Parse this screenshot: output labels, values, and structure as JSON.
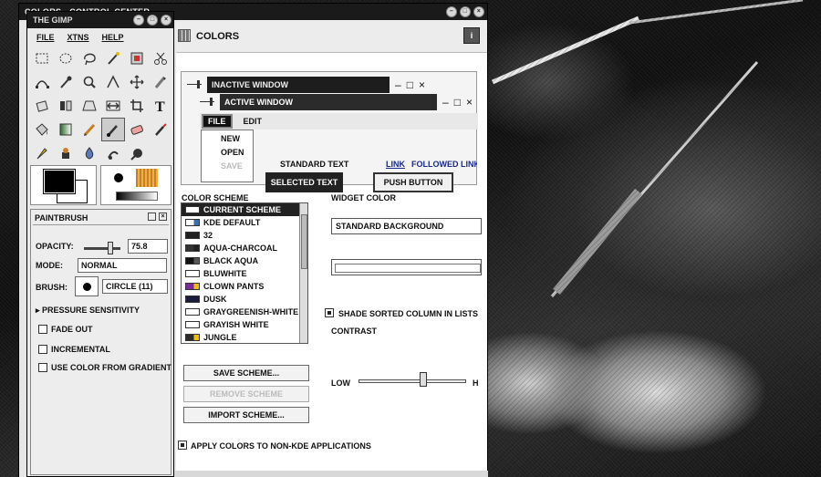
{
  "colors_window": {
    "title": "COLORS - CONTROL CENTER",
    "header_title": "COLORS",
    "info_label": "i"
  },
  "preview": {
    "inactive_title": "INACTIVE WINDOW",
    "active_title": "ACTIVE WINDOW",
    "menu_file": "FILE",
    "menu_edit": "EDIT",
    "dropdown": [
      "NEW",
      "OPEN",
      "SAVE"
    ],
    "standard_text": "STANDARD TEXT",
    "selected_text": "SELECTED TEXT",
    "link": "LINK",
    "followed_link": "FOLLOWED LINK",
    "push_button": "PUSH BUTTON"
  },
  "color_scheme": {
    "label": "COLOR SCHEME",
    "items": [
      {
        "name": "CURRENT SCHEME",
        "swatch": "#ffffff",
        "accent": "#ffffff",
        "selected": true
      },
      {
        "name": "KDE DEFAULT",
        "swatch": "#ffffff",
        "accent": "#3a6fb0"
      },
      {
        "name": "32",
        "swatch": "#222222",
        "accent": "#222222"
      },
      {
        "name": "AQUA-CHARCOAL",
        "swatch": "#333333",
        "accent": "#222222"
      },
      {
        "name": "BLACK AQUA",
        "swatch": "#111111",
        "accent": "#555555"
      },
      {
        "name": "BLUWHITE",
        "swatch": "#ffffff",
        "accent": "#ffffff"
      },
      {
        "name": "CLOWN PANTS",
        "swatch": "#7a2a9a",
        "accent": "#f0c000"
      },
      {
        "name": "DUSK",
        "swatch": "#1a1a3a",
        "accent": "#1a1a3a"
      },
      {
        "name": "GRAYGREENISH-WHITE",
        "swatch": "#ffffff",
        "accent": "#ffffff"
      },
      {
        "name": "GRAYISH WHITE",
        "swatch": "#ffffff",
        "accent": "#ffffff"
      },
      {
        "name": "JUNGLE",
        "swatch": "#2a2a2a",
        "accent": "#f0c000"
      },
      {
        "name": "...",
        "swatch": "#dddddd",
        "accent": "#dddddd"
      }
    ],
    "save_button": "SAVE SCHEME...",
    "remove_button": "REMOVE SCHEME",
    "import_button": "IMPORT SCHEME..."
  },
  "widget_color": {
    "label": "WIDGET COLOR",
    "selected_widget": "STANDARD BACKGROUND",
    "shade_sorted": "SHADE SORTED COLUMN IN LISTS",
    "contrast_label": "CONTRAST",
    "low_label": "LOW",
    "high_label": "H",
    "contrast_level": 0.6
  },
  "apply_nonkde": "APPLY COLORS TO NON-KDE APPLICATIONS",
  "gimp": {
    "title": "THE GIMP",
    "menu": [
      "FILE",
      "XTNS",
      "HELP"
    ],
    "tools": [
      "rect-select-icon",
      "ellipse-select-icon",
      "lasso-icon",
      "magic-wand-icon",
      "color-select-icon",
      "scissors-icon",
      "bezier-icon",
      "color-picker-icon",
      "magnify-icon",
      "measure-icon",
      "move-icon",
      "smudge-icon",
      "transform-icon",
      "flip-icon",
      "perspective-icon",
      "resize-icon",
      "crop-icon",
      "text-icon",
      "bucket-fill-icon",
      "gradient-icon",
      "pencil-icon",
      "paintbrush-icon",
      "eraser-icon",
      "airbrush-icon",
      "ink-icon",
      "clone-icon",
      "dodge-icon",
      "convolve-icon",
      "smudge2-icon"
    ],
    "active_tool_index": 21,
    "fg_color": "#000000",
    "bg_color": "#ffffff",
    "options": {
      "title": "PAINTBRUSH",
      "opacity_label": "OPACITY:",
      "opacity_value": "75.8",
      "mode_label": "MODE:",
      "mode_value": "NORMAL",
      "brush_label": "BRUSH:",
      "brush_value": "CIRCLE (11)",
      "pressure_label": "PRESSURE SENSITIVITY",
      "fade_out": "FADE OUT",
      "incremental": "INCREMENTAL",
      "use_gradient": "USE COLOR FROM GRADIENT"
    }
  }
}
